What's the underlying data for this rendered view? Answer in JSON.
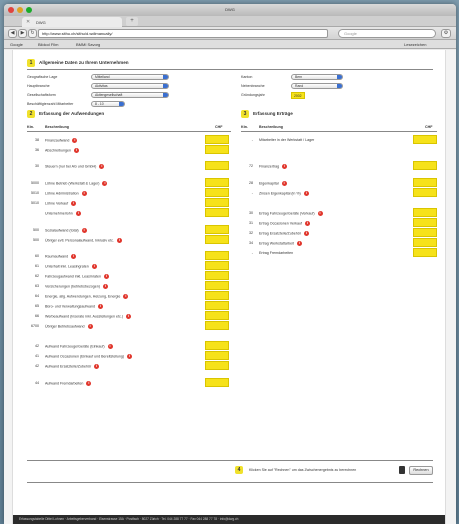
{
  "browser": {
    "window_title": "DWG",
    "tab_title": "DWG",
    "url": "http://www.sithu.ch/sithu/d.wdlmanualiy/",
    "search_placeholder": "Google",
    "bookmarks": [
      "Google",
      "Bildcol Film",
      "BMMI Savorg"
    ],
    "bookmarks_right": "Lesezeichen",
    "nav": {
      "back": "◀",
      "forward": "▶",
      "reload": "↻"
    }
  },
  "section1": {
    "step": "1",
    "title": "Allgemeine Daten zu Ihrem Unternehmen",
    "fields_left": [
      {
        "label": "Geografische Lage",
        "value": "Mittelland"
      },
      {
        "label": "Hauptbranche",
        "value": "Aktivitas"
      },
      {
        "label": "Gesellschaftsform",
        "value": "Aktiengesellschaft"
      },
      {
        "label": "Beschäftigtenzahl Mitarbeiter",
        "value": "8 - 10"
      }
    ],
    "fields_right": [
      {
        "label": "Kanton",
        "value": "Bern"
      },
      {
        "label": "Nebenbranche",
        "value": "Rand"
      },
      {
        "label": "Gründungsjahr",
        "value": "2002"
      }
    ]
  },
  "section2": {
    "step": "2",
    "title": "Erfassung der Aufwendungen",
    "col_nr": "Ktn.",
    "col_desc": "Beschreibung",
    "col_chf": "CHF",
    "rows": [
      {
        "nr": "38",
        "desc": "Finanzaufwand"
      },
      {
        "nr": "36",
        "desc": "Abschreibungen"
      },
      {
        "nr": "30",
        "desc": "Steuern (nur bei AG und GmbH)"
      },
      {
        "nr": "5000",
        "desc": "Löhne Betrieb (Werkstatt & Lager)"
      },
      {
        "nr": "5010",
        "desc": "Löhne Administration"
      },
      {
        "nr": "5010",
        "desc": "Löhne Verkauf"
      },
      {
        "nr": "",
        "desc": "Unternehmerlohn"
      },
      {
        "nr": "500",
        "desc": "Sozialaufwand (total)"
      },
      {
        "nr": "500",
        "desc": "Übriger evtl. Personalaufwand, Inklusiv etc."
      },
      {
        "nr": "60",
        "desc": "Raumaufwand"
      },
      {
        "nr": "61",
        "desc": "Unterhalt inkl. Leasingraten"
      },
      {
        "nr": "62",
        "desc": "Fahrzeugaufwand inkl. Leasinraten"
      },
      {
        "nr": "63",
        "desc": "Versicherungen (betriebsbezogen)"
      },
      {
        "nr": "64",
        "desc": "Energie, allg. Aufwendungen, Heizung, Energie"
      },
      {
        "nr": "65",
        "desc": "Büro- und Verwaltungsaufwand"
      },
      {
        "nr": "66",
        "desc": "Werbeaufwand (Inserate inkl. Ausstellungen etc.)"
      },
      {
        "nr": "6700",
        "desc": "Übriger Betriebsaufwand"
      },
      {
        "nr": "42",
        "desc": "Aufwand Fahrzeuge/Geräte (Einkauf)"
      },
      {
        "nr": "41",
        "desc": "Aufwand Occasionen (Einkauf und Bereitstellung)"
      },
      {
        "nr": "42",
        "desc": "Aufwand Ersatzteile/Zubehör"
      },
      {
        "nr": "44",
        "desc": "Aufwand Fremdarbeiten"
      }
    ]
  },
  "section3": {
    "step": "3",
    "title": "Erfassung Erträge",
    "col_nr": "Ktn.",
    "col_desc": "Beschreibung",
    "col_chf": "CHF",
    "rows": [
      {
        "nr": "-",
        "desc": "Mitarbeiter in der Werkstatt / Lager"
      },
      {
        "nr": "72",
        "desc": "Finanzertrag"
      },
      {
        "nr": "28",
        "desc": "Eigenkapital"
      },
      {
        "nr": "-",
        "desc": "Zinsen Eigenkapital (in %)"
      },
      {
        "nr": "30",
        "desc": "Ertrag Fahrzeuge/Geräte (Verkauf)"
      },
      {
        "nr": "31",
        "desc": "Ertrag Occasionen Verkauf"
      },
      {
        "nr": "32",
        "desc": "Ertrag Ersatzteile/Zubehör"
      },
      {
        "nr": "34",
        "desc": "Ertrag Werkstattarbeit"
      },
      {
        "nr": "-",
        "desc": "Ertrag Fremdarbeiten"
      }
    ]
  },
  "section4": {
    "step": "4",
    "text": "Klicken Sie auf \"Rechnen\" um das Zwischenergebnis zu berechnen",
    "button": "Rechnen"
  },
  "footer": "Erfassungstabelle Dittel Lohnen · Arbeitsgeberverband · Eisenstrasse 15A · Postfach · 8027 Zürich · Tel. 044 288 77 77 · Fax 044 288 77 78 · info@dwg.ch",
  "colors": {
    "accent_yellow": "#f6e21a",
    "info_red": "#e0352b"
  }
}
